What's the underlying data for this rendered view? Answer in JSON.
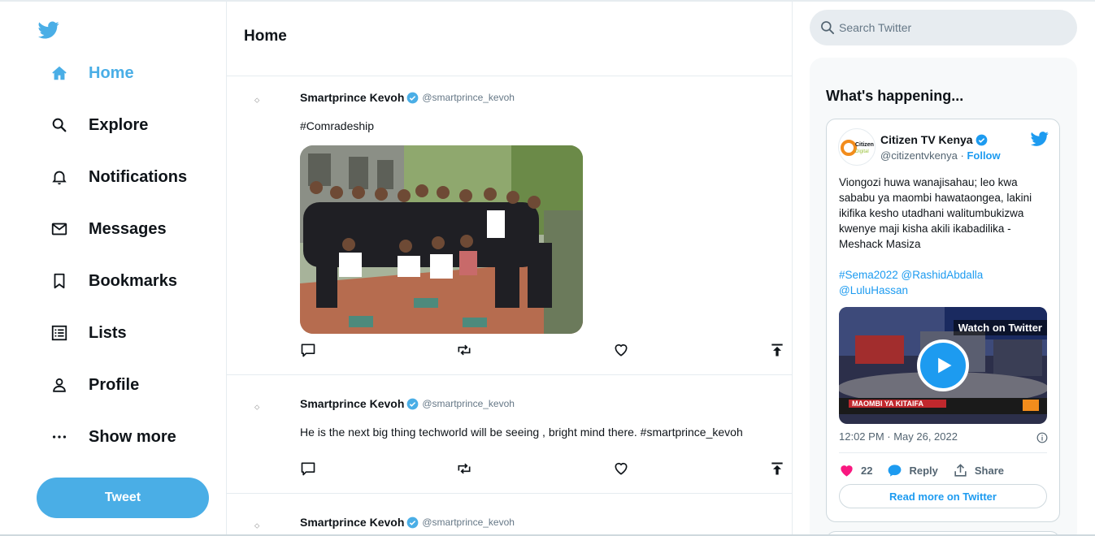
{
  "colors": {
    "accent": "#4aaee6",
    "link": "#1d9bf0",
    "like": "#f91880"
  },
  "sidebar": {
    "logo_icon": "twitter-bird-icon",
    "items": [
      {
        "label": "Home",
        "icon": "home-icon",
        "active": true
      },
      {
        "label": "Explore",
        "icon": "search-icon"
      },
      {
        "label": "Notifications",
        "icon": "bell-icon"
      },
      {
        "label": "Messages",
        "icon": "envelope-icon"
      },
      {
        "label": "Bookmarks",
        "icon": "bookmark-icon"
      },
      {
        "label": "Lists",
        "icon": "list-icon"
      },
      {
        "label": "Profile",
        "icon": "person-icon"
      },
      {
        "label": "Show more",
        "icon": "more-icon"
      }
    ],
    "tweet_button": "Tweet"
  },
  "main": {
    "title": "Home",
    "tweets": [
      {
        "name": "Smartprince Kevoh",
        "handle": "@smartprince_kevoh",
        "text": "#Comradeship",
        "has_media": true
      },
      {
        "name": "Smartprince Kevoh",
        "handle": "@smartprince_kevoh",
        "text": "He is the next big thing techworld will be seeing , bright mind there. #smartprince_kevoh",
        "has_media": false
      },
      {
        "name": "Smartprince Kevoh",
        "handle": "@smartprince_kevoh",
        "text": "",
        "has_media": false
      }
    ]
  },
  "search": {
    "placeholder": "Search Twitter"
  },
  "trends": {
    "title": "What's happening...",
    "embed": {
      "name": "Citizen TV Kenya",
      "handle": "@citizentvkenya",
      "separator": "·",
      "follow": "Follow",
      "avatar_text_1": "Citizen",
      "avatar_text_2": "Digital",
      "text": "Viongozi huwa wanajisahau; leo kwa sababu ya maombi hawataongea, lakini ikifika kesho utadhani walitumbukizwa kwenye maji kisha akili ikabadilika - Meshack Masiza",
      "tags": "#Sema2022 @RashidAbdalla @LuluHassan",
      "watch_label": "Watch on Twitter",
      "video_caption": "MAOMBI YA KITAIFA",
      "time": "12:02 PM · May 26, 2022",
      "likes": "22",
      "reply": "Reply",
      "share": "Share",
      "read_more": "Read more on Twitter"
    }
  }
}
